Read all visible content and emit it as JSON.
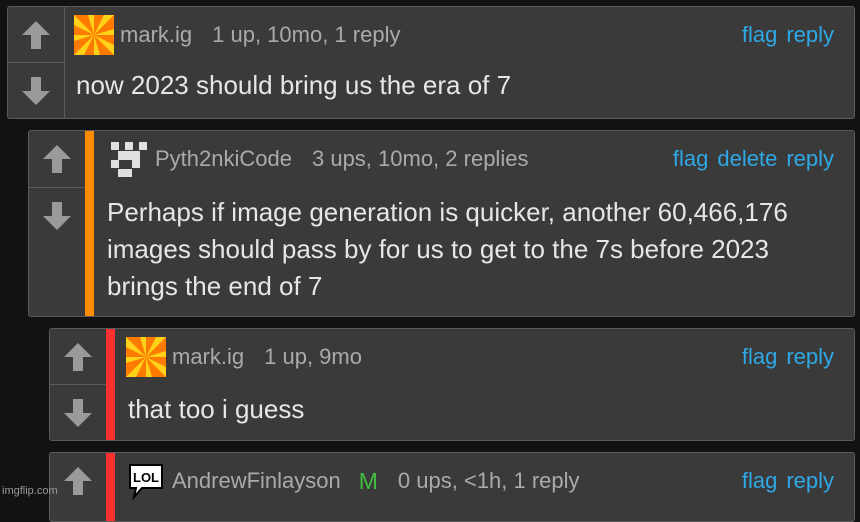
{
  "comments": [
    {
      "username": "mark.ig",
      "meta": "1 up, 10mo, 1 reply",
      "actions": [
        "flag",
        "reply"
      ],
      "text": "now 2023 should bring us the era of 7"
    },
    {
      "username": "Pyth2nkiCode",
      "meta": "3 ups, 10mo, 2 replies",
      "actions": [
        "flag",
        "delete",
        "reply"
      ],
      "text": "Perhaps if image generation is quicker, another 60,466,176 images should pass by for us to get to the 7s before 2023 brings the end of 7",
      "accent_color": "#ff8c00"
    },
    {
      "username": "mark.ig",
      "meta": "1 up, 9mo",
      "actions": [
        "flag",
        "reply"
      ],
      "text": "that too i guess",
      "accent_color": "#ff3030"
    },
    {
      "username": "AndrewFinlayson",
      "mod_badge": "M",
      "avatar_text": "LOL",
      "meta": "0 ups, <1h, 1 reply",
      "actions": [
        "flag",
        "reply"
      ],
      "accent_color": "#ff3030"
    }
  ],
  "watermark": "imgflip.com",
  "colors": {
    "link": "#2fa8e6",
    "mod": "#3fbf3f",
    "panel": "#3a3a3a"
  }
}
